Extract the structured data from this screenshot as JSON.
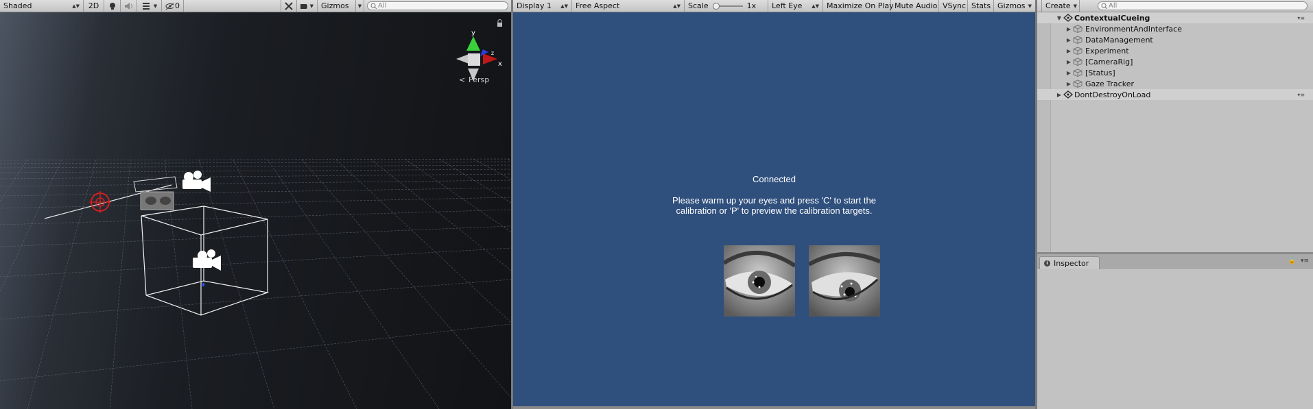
{
  "scene_toolbar": {
    "draw_mode": "Shaded",
    "toggle_2d": "2D",
    "hidden_count": "0",
    "gizmos_label": "Gizmos",
    "search_placeholder": "All"
  },
  "scene_view": {
    "projection_label": "Persp",
    "gizmo_y": "y",
    "gizmo_x": "x",
    "gizmo_z": "z"
  },
  "game_toolbar": {
    "display": "Display 1",
    "aspect": "Free Aspect",
    "scale_label": "Scale",
    "scale_value": "1x",
    "eye": "Left Eye",
    "maximize": "Maximize On Play",
    "mute": "Mute Audio",
    "vsync": "VSync",
    "stats": "Stats",
    "gizmos": "Gizmos"
  },
  "game_view": {
    "status": "Connected",
    "instruction_line1": "Please warm up your eyes and press 'C' to start the",
    "instruction_line2": "calibration or 'P' to preview the calibration targets.",
    "background_color": "#2f4f7d"
  },
  "hierarchy": {
    "create_label": "Create",
    "search_placeholder": "All",
    "scene_name": "ContextualCueing",
    "children": [
      "EnvironmentAndInterface",
      "DataManagement",
      "Experiment",
      "[CameraRig]",
      "[Status]",
      "Gaze Tracker"
    ],
    "dont_destroy": "DontDestroyOnLoad"
  },
  "inspector": {
    "tab_label": "Inspector"
  }
}
